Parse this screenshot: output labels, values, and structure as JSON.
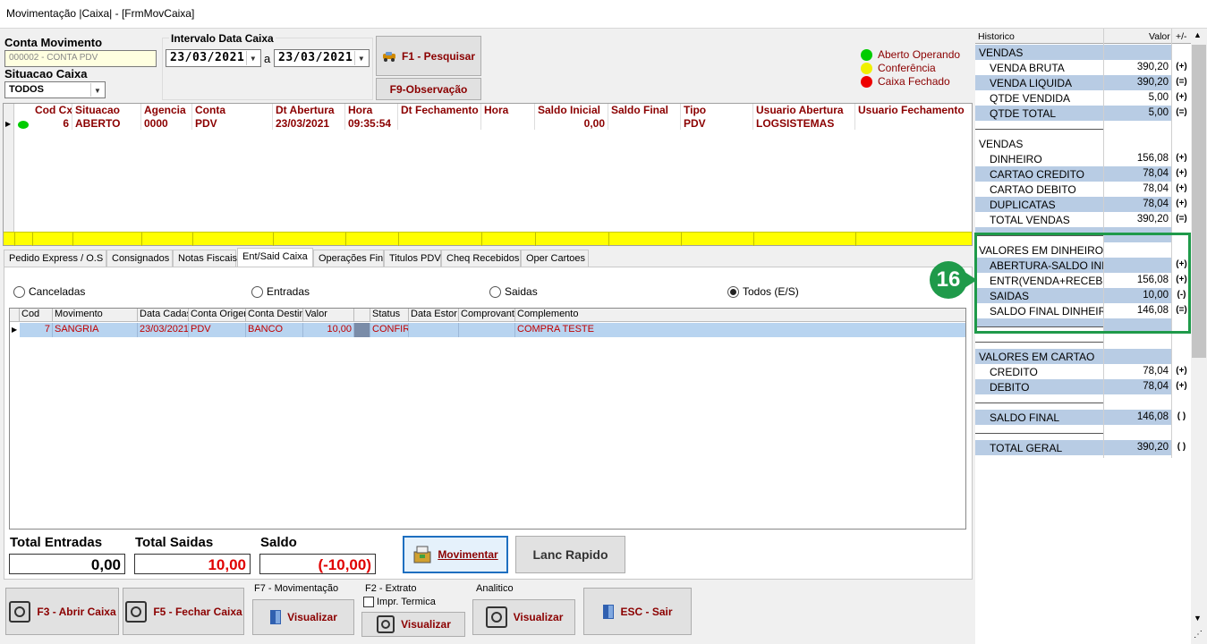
{
  "window": {
    "title": "Movimentação |Caixa| - [FrmMovCaixa]"
  },
  "filters": {
    "conta_label": "Conta Movimento",
    "conta_value": "000002 - CONTA PDV",
    "situacao_label": "Situacao Caixa",
    "situacao_value": "TODOS",
    "intervalo_label": "Intervalo Data Caixa",
    "date_from": "23/03/2021",
    "date_sep": "a",
    "date_to": "23/03/2021",
    "pesquisar": "F1 - Pesquisar",
    "observacao": "F9-Observação"
  },
  "legend": [
    {
      "label": "Aberto Operando",
      "color": "#00cc00"
    },
    {
      "label": "Conferência",
      "color": "#f0f000"
    },
    {
      "label": "Caixa Fechado",
      "color": "#ee0000"
    }
  ],
  "main_grid": {
    "headers": [
      "Cod Cx",
      "Situacao",
      "Agencia",
      "Conta",
      "Dt Abertura",
      "Hora",
      "Dt Fechamento",
      "Hora",
      "Saldo Inicial",
      "Saldo Final",
      "Tipo",
      "Usuario Abertura",
      "Usuario Fechamento"
    ],
    "row": [
      "6",
      "ABERTO",
      "0000",
      "PDV",
      "23/03/2021",
      "09:35:54",
      "",
      "",
      "0,00",
      "",
      "PDV",
      "LOGSISTEMAS",
      ""
    ]
  },
  "tabs": [
    "Pedido Express / O.S",
    "Consignados",
    "Notas Fiscais",
    "Ent/Said Caixa",
    "Operações Fin",
    "Titulos PDV",
    "Cheq Recebidos",
    "Oper Cartoes"
  ],
  "radios": [
    "Canceladas",
    "Entradas",
    "Saidas",
    "Todos (E/S)"
  ],
  "mov_grid": {
    "headers": [
      "Cod",
      "Movimento",
      "Data Cadas",
      "Conta Origem",
      "Conta Destino",
      "Valor",
      "",
      "Status",
      "Data Estor",
      "Comprovant",
      "Complemento"
    ],
    "row": [
      "7",
      "SANGRIA",
      "23/03/2021",
      "PDV",
      "BANCO",
      "10,00",
      "",
      "CONFIRMADO",
      "",
      "",
      "COMPRA TESTE"
    ]
  },
  "totals": {
    "entradas_label": "Total Entradas",
    "entradas": "0,00",
    "saidas_label": "Total Saidas",
    "saidas": "10,00",
    "saldo_label": "Saldo",
    "saldo": "(-10,00)",
    "movimentar": "Movimentar",
    "lanc": "Lanc Rapido"
  },
  "bottom": {
    "abrir": "F3 - Abrir Caixa",
    "fechar": "F5 - Fechar Caixa",
    "f7_label": "F7 - Movimentação",
    "f2_label": "F2 - Extrato",
    "impr": "Impr. Termica",
    "analitico_label": "Analitico",
    "visualizar": "Visualizar",
    "sair": "ESC - Sair"
  },
  "summary": {
    "headers": [
      "Historico",
      "Valor",
      "+/-"
    ],
    "badge": "16",
    "rows": [
      {
        "h": "VENDAS",
        "v": "",
        "s": "",
        "type": "blue"
      },
      {
        "h": "VENDA BRUTA",
        "v": "390,20",
        "s": "(+)",
        "type": "ind"
      },
      {
        "h": "VENDA LIQUIDA",
        "v": "390,20",
        "s": "(=)",
        "type": "ind blue"
      },
      {
        "h": "QTDE VENDIDA",
        "v": "5,00",
        "s": "(+)",
        "type": "ind"
      },
      {
        "h": "QTDE TOTAL",
        "v": "5,00",
        "s": "(=)",
        "type": "ind blue"
      },
      {
        "h": "",
        "v": "",
        "s": "",
        "type": "sep"
      },
      {
        "h": "VENDAS",
        "v": "",
        "s": "",
        "type": ""
      },
      {
        "h": "DINHEIRO",
        "v": "156,08",
        "s": "(+)",
        "type": "ind"
      },
      {
        "h": "CARTAO CREDITO",
        "v": "78,04",
        "s": "(+)",
        "type": "ind blue"
      },
      {
        "h": "CARTAO DEBITO",
        "v": "78,04",
        "s": "(+)",
        "type": "ind"
      },
      {
        "h": "DUPLICATAS",
        "v": "78,04",
        "s": "(+)",
        "type": "ind blue"
      },
      {
        "h": "TOTAL VENDAS",
        "v": "390,20",
        "s": "(=)",
        "type": "ind"
      },
      {
        "h": "",
        "v": "",
        "s": "",
        "type": "sep blue"
      },
      {
        "h": "VALORES EM DINHEIRO",
        "v": "",
        "s": "",
        "type": ""
      },
      {
        "h": "ABERTURA-SALDO INICIAL",
        "v": "",
        "s": "(+)",
        "type": "ind blue"
      },
      {
        "h": "ENTR(VENDA+RECEB-PGTO)",
        "v": "156,08",
        "s": "(+)",
        "type": "ind"
      },
      {
        "h": "SAIDAS",
        "v": "10,00",
        "s": "(-)",
        "type": "ind blue"
      },
      {
        "h": "SALDO FINAL DINHEIRO",
        "v": "146,08",
        "s": "(=)",
        "type": "ind"
      },
      {
        "h": "",
        "v": "",
        "s": "",
        "type": "sep blue"
      },
      {
        "h": "",
        "v": "",
        "s": "",
        "type": "sep"
      },
      {
        "h": "VALORES EM CARTAO",
        "v": "",
        "s": "",
        "type": "blue"
      },
      {
        "h": "CREDITO",
        "v": "78,04",
        "s": "(+)",
        "type": "ind"
      },
      {
        "h": "DEBITO",
        "v": "78,04",
        "s": "(+)",
        "type": "ind blue"
      },
      {
        "h": "",
        "v": "",
        "s": "",
        "type": "sep"
      },
      {
        "h": "SALDO FINAL",
        "v": "146,08",
        "s": "( )",
        "type": "ind blue"
      },
      {
        "h": "",
        "v": "",
        "s": "",
        "type": "sep"
      },
      {
        "h": "TOTAL GERAL",
        "v": "390,20",
        "s": "( )",
        "type": "ind blue"
      }
    ]
  }
}
